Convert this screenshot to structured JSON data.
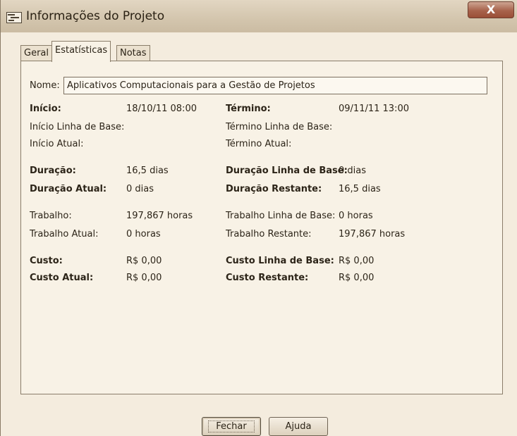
{
  "window": {
    "title": "Informações do Projeto",
    "close_label": "X"
  },
  "tabs": [
    {
      "label": "Geral"
    },
    {
      "label": "Estatísticas"
    },
    {
      "label": "Notas"
    }
  ],
  "name": {
    "label": "Nome:",
    "value": "Aplicativos Computacionais para a Gestão de Projetos"
  },
  "stats": {
    "inicio": {
      "label": "Início:",
      "value": "18/10/11 08:00"
    },
    "termino": {
      "label": "Término:",
      "value": "09/11/11 13:00"
    },
    "inicio_base": {
      "label": "Início Linha de Base:",
      "value": ""
    },
    "termino_base": {
      "label": "Término Linha de Base:",
      "value": ""
    },
    "inicio_atual": {
      "label": "Início Atual:",
      "value": ""
    },
    "termino_atual": {
      "label": "Término Atual:",
      "value": ""
    },
    "duracao": {
      "label": "Duração:",
      "value": "16,5 dias"
    },
    "duracao_base": {
      "label": "Duração Linha de Base:",
      "value": "0 dias"
    },
    "duracao_atual": {
      "label": "Duração Atual:",
      "value": "0 dias"
    },
    "duracao_restante": {
      "label": "Duração Restante:",
      "value": "16,5 dias"
    },
    "trabalho": {
      "label": "Trabalho:",
      "value": "197,867 horas"
    },
    "trabalho_base": {
      "label": "Trabalho Linha de Base:",
      "value": "0 horas"
    },
    "trabalho_atual": {
      "label": "Trabalho Atual:",
      "value": "0 horas"
    },
    "trabalho_restante": {
      "label": "Trabalho Restante:",
      "value": "197,867 horas"
    },
    "custo": {
      "label": "Custo:",
      "value": "R$ 0,00"
    },
    "custo_base": {
      "label": "Custo Linha de Base:",
      "value": "R$ 0,00"
    },
    "custo_atual": {
      "label": "Custo Atual:",
      "value": "R$ 0,00"
    },
    "custo_restante": {
      "label": "Custo Restante:",
      "value": "R$ 0,00"
    }
  },
  "buttons": {
    "close": "Fechar",
    "help": "Ajuda"
  }
}
